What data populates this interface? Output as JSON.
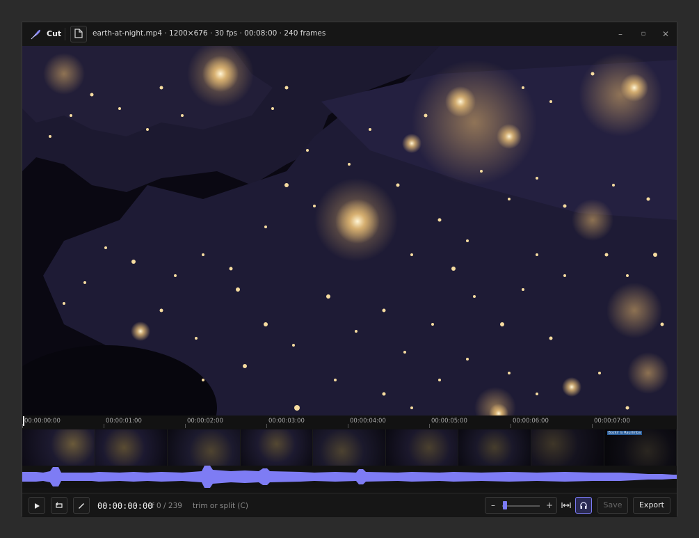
{
  "app": {
    "name": "Cut",
    "icon": "feather-icon"
  },
  "file": {
    "info": "earth-at-night.mp4 · 1200×676 · 30 fps · 00:08:00 · 240 frames",
    "icon": "file-icon"
  },
  "window_controls": {
    "minimize": "–",
    "maximize": "▫",
    "close": "✕"
  },
  "ruler": {
    "ticks": [
      "00:00:00:00",
      "00:00:01:00",
      "00:00:02:00",
      "00:00:03:00",
      "00:00:04:00",
      "00:00:05:00",
      "00:00:06:00",
      "00:00:07:00"
    ]
  },
  "thumbnail_overlay_text": "Bozkir is Raurimba",
  "controls": {
    "timecode": "00:00:00:00",
    "frame_counter": "f 0 / 239",
    "hint": "trim or split (C)",
    "zoom_out": "–",
    "zoom_in": "+",
    "save": "Save",
    "export": "Export"
  },
  "colors": {
    "accent": "#7b7bf5",
    "waveform": "#7e7cf4",
    "background": "#2b2b2b",
    "panel": "#141414"
  }
}
